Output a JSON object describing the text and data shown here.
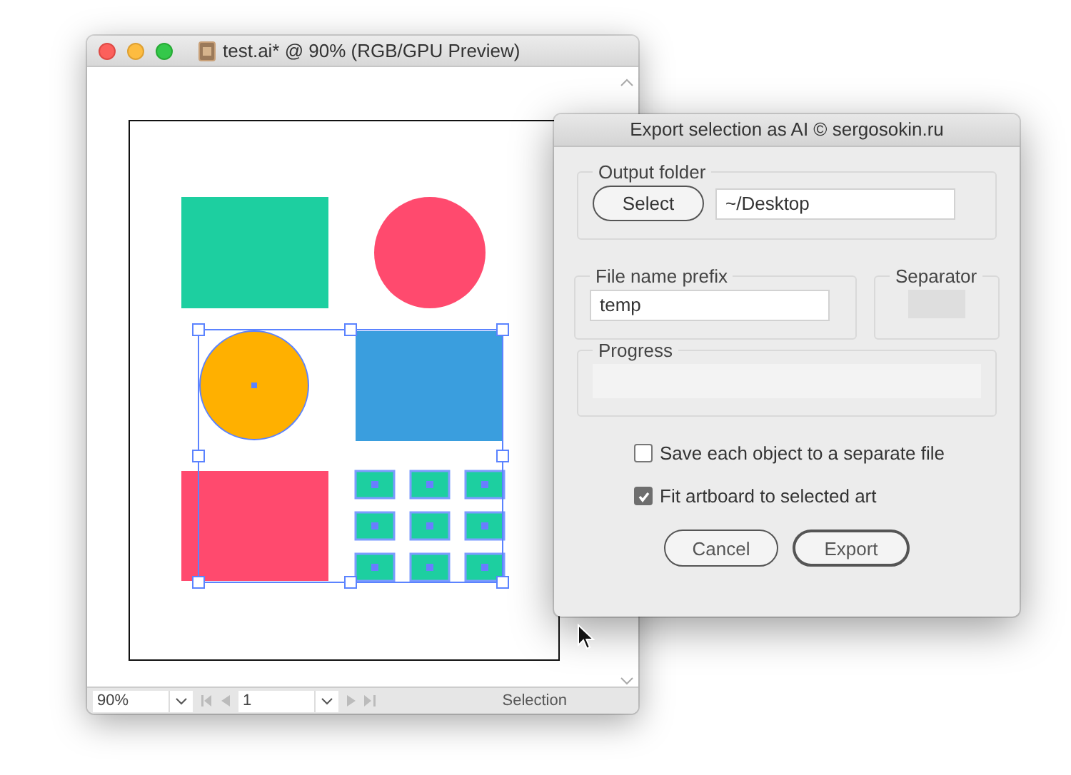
{
  "document_window": {
    "title": "test.ai* @ 90% (RGB/GPU Preview)",
    "status_bar": {
      "zoom": "90%",
      "page": "1",
      "tool": "Selection"
    }
  },
  "dialog": {
    "title": "Export selection as AI  © sergosokin.ru",
    "output_folder": {
      "label": "Output folder",
      "button": "Select",
      "value": "~/Desktop"
    },
    "prefix": {
      "label": "File name prefix",
      "value": "temp"
    },
    "separator": {
      "label": "Separator",
      "disabled": true
    },
    "progress": {
      "label": "Progress",
      "level": 0
    },
    "options": [
      {
        "label": "Save each object to a separate file",
        "checked": false
      },
      {
        "label": "Fit artboard to selected art",
        "checked": true
      }
    ],
    "buttons": [
      {
        "label": "Cancel",
        "default": false
      },
      {
        "label": "Export",
        "default": true
      }
    ]
  }
}
